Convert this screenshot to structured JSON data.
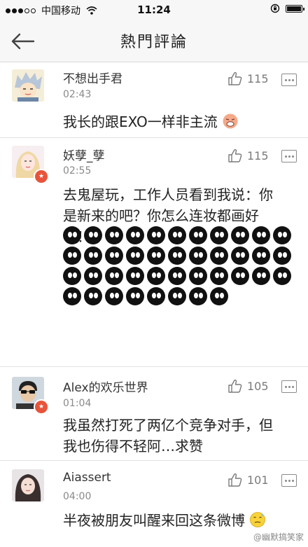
{
  "status_bar": {
    "carrier": "中国移动",
    "time": "11:24"
  },
  "nav": {
    "title": "熱門評論"
  },
  "comments": [
    {
      "username": "不想出手君",
      "time": "02:43",
      "likes": "115",
      "text": "我长的跟EXO一样非主流",
      "verified": false
    },
    {
      "username": "妖孽_孽",
      "time": "02:55",
      "likes": "115",
      "text_lines": [
        "去鬼屋玩，工作人员看到我说：你",
        "是新来的吧？你怎么连妆都画好",
        "了！"
      ],
      "verified": true,
      "emoji_count": 41
    },
    {
      "username": "Alex的欢乐世界",
      "time": "01:04",
      "likes": "105",
      "text_lines": [
        "我虽然打死了两亿个竞争对手，但",
        "我也伤得不轻阿…求赞"
      ],
      "verified": true
    },
    {
      "username": "Aiassert",
      "time": "04:00",
      "likes": "101",
      "text": "半夜被朋友叫醒来回这条微博",
      "verified": false
    }
  ],
  "watermark": "@幽默搞笑家"
}
